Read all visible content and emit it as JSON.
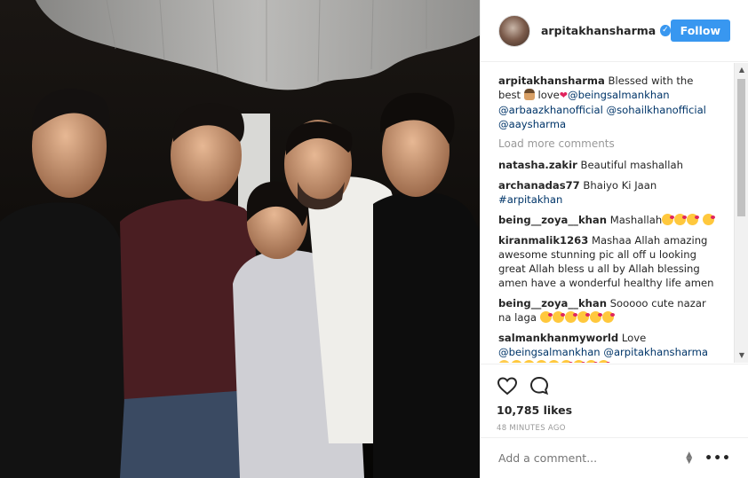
{
  "header": {
    "username": "arpitakhansharma",
    "follow_label": "Follow"
  },
  "comments": [
    {
      "user": "arpitakhansharma",
      "text": "Blessed with the best",
      "text2": "love",
      "mentions": [
        "@beingsalmankhan",
        "@arbaazkhanofficial",
        "@sohailkhanofficial",
        "@aaysharma"
      ]
    },
    {
      "user": "natasha.zakir",
      "text": "Beautiful mashallah"
    },
    {
      "user": "archanadas77",
      "text": "Bhaiyo Ki Jaan",
      "tag": "#arpitakhan"
    },
    {
      "user": "being__zoya__khan",
      "text": "Mashallah"
    },
    {
      "user": "kiranmalik1263",
      "text": "Mashaa Allah amazing awesome stunning pic all off u looking great Allah bless u all by Allah blessing amen have a wonderful healthy life amen"
    },
    {
      "user": "being__zoya__khan",
      "text": "Sooooo cute nazar na laga"
    },
    {
      "user": "salmankhanmyworld",
      "text": "Love",
      "mentions": [
        "@beingsalmankhan",
        "@arpitakhansharma"
      ]
    }
  ],
  "load_more": "Load more comments",
  "likes": "10,785 likes",
  "time": "48 MINUTES AGO",
  "add_comment_placeholder": "Add a comment...",
  "colors": {
    "accent": "#3897f0",
    "link": "#003569",
    "muted": "#999999"
  }
}
